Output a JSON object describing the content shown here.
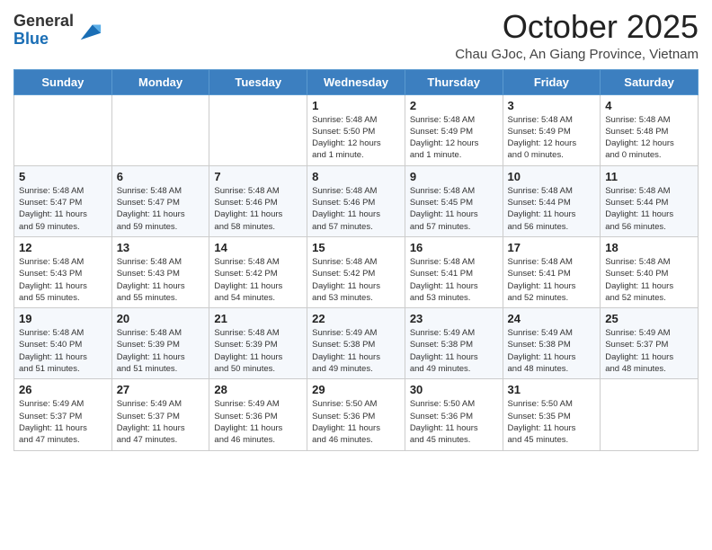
{
  "header": {
    "logo_general": "General",
    "logo_blue": "Blue",
    "month_title": "October 2025",
    "location": "Chau GJoc, An Giang Province, Vietnam"
  },
  "days_of_week": [
    "Sunday",
    "Monday",
    "Tuesday",
    "Wednesday",
    "Thursday",
    "Friday",
    "Saturday"
  ],
  "weeks": [
    [
      {
        "day": "",
        "info": ""
      },
      {
        "day": "",
        "info": ""
      },
      {
        "day": "",
        "info": ""
      },
      {
        "day": "1",
        "info": "Sunrise: 5:48 AM\nSunset: 5:50 PM\nDaylight: 12 hours\nand 1 minute."
      },
      {
        "day": "2",
        "info": "Sunrise: 5:48 AM\nSunset: 5:49 PM\nDaylight: 12 hours\nand 1 minute."
      },
      {
        "day": "3",
        "info": "Sunrise: 5:48 AM\nSunset: 5:49 PM\nDaylight: 12 hours\nand 0 minutes."
      },
      {
        "day": "4",
        "info": "Sunrise: 5:48 AM\nSunset: 5:48 PM\nDaylight: 12 hours\nand 0 minutes."
      }
    ],
    [
      {
        "day": "5",
        "info": "Sunrise: 5:48 AM\nSunset: 5:47 PM\nDaylight: 11 hours\nand 59 minutes."
      },
      {
        "day": "6",
        "info": "Sunrise: 5:48 AM\nSunset: 5:47 PM\nDaylight: 11 hours\nand 59 minutes."
      },
      {
        "day": "7",
        "info": "Sunrise: 5:48 AM\nSunset: 5:46 PM\nDaylight: 11 hours\nand 58 minutes."
      },
      {
        "day": "8",
        "info": "Sunrise: 5:48 AM\nSunset: 5:46 PM\nDaylight: 11 hours\nand 57 minutes."
      },
      {
        "day": "9",
        "info": "Sunrise: 5:48 AM\nSunset: 5:45 PM\nDaylight: 11 hours\nand 57 minutes."
      },
      {
        "day": "10",
        "info": "Sunrise: 5:48 AM\nSunset: 5:44 PM\nDaylight: 11 hours\nand 56 minutes."
      },
      {
        "day": "11",
        "info": "Sunrise: 5:48 AM\nSunset: 5:44 PM\nDaylight: 11 hours\nand 56 minutes."
      }
    ],
    [
      {
        "day": "12",
        "info": "Sunrise: 5:48 AM\nSunset: 5:43 PM\nDaylight: 11 hours\nand 55 minutes."
      },
      {
        "day": "13",
        "info": "Sunrise: 5:48 AM\nSunset: 5:43 PM\nDaylight: 11 hours\nand 55 minutes."
      },
      {
        "day": "14",
        "info": "Sunrise: 5:48 AM\nSunset: 5:42 PM\nDaylight: 11 hours\nand 54 minutes."
      },
      {
        "day": "15",
        "info": "Sunrise: 5:48 AM\nSunset: 5:42 PM\nDaylight: 11 hours\nand 53 minutes."
      },
      {
        "day": "16",
        "info": "Sunrise: 5:48 AM\nSunset: 5:41 PM\nDaylight: 11 hours\nand 53 minutes."
      },
      {
        "day": "17",
        "info": "Sunrise: 5:48 AM\nSunset: 5:41 PM\nDaylight: 11 hours\nand 52 minutes."
      },
      {
        "day": "18",
        "info": "Sunrise: 5:48 AM\nSunset: 5:40 PM\nDaylight: 11 hours\nand 52 minutes."
      }
    ],
    [
      {
        "day": "19",
        "info": "Sunrise: 5:48 AM\nSunset: 5:40 PM\nDaylight: 11 hours\nand 51 minutes."
      },
      {
        "day": "20",
        "info": "Sunrise: 5:48 AM\nSunset: 5:39 PM\nDaylight: 11 hours\nand 51 minutes."
      },
      {
        "day": "21",
        "info": "Sunrise: 5:48 AM\nSunset: 5:39 PM\nDaylight: 11 hours\nand 50 minutes."
      },
      {
        "day": "22",
        "info": "Sunrise: 5:49 AM\nSunset: 5:38 PM\nDaylight: 11 hours\nand 49 minutes."
      },
      {
        "day": "23",
        "info": "Sunrise: 5:49 AM\nSunset: 5:38 PM\nDaylight: 11 hours\nand 49 minutes."
      },
      {
        "day": "24",
        "info": "Sunrise: 5:49 AM\nSunset: 5:38 PM\nDaylight: 11 hours\nand 48 minutes."
      },
      {
        "day": "25",
        "info": "Sunrise: 5:49 AM\nSunset: 5:37 PM\nDaylight: 11 hours\nand 48 minutes."
      }
    ],
    [
      {
        "day": "26",
        "info": "Sunrise: 5:49 AM\nSunset: 5:37 PM\nDaylight: 11 hours\nand 47 minutes."
      },
      {
        "day": "27",
        "info": "Sunrise: 5:49 AM\nSunset: 5:37 PM\nDaylight: 11 hours\nand 47 minutes."
      },
      {
        "day": "28",
        "info": "Sunrise: 5:49 AM\nSunset: 5:36 PM\nDaylight: 11 hours\nand 46 minutes."
      },
      {
        "day": "29",
        "info": "Sunrise: 5:50 AM\nSunset: 5:36 PM\nDaylight: 11 hours\nand 46 minutes."
      },
      {
        "day": "30",
        "info": "Sunrise: 5:50 AM\nSunset: 5:36 PM\nDaylight: 11 hours\nand 45 minutes."
      },
      {
        "day": "31",
        "info": "Sunrise: 5:50 AM\nSunset: 5:35 PM\nDaylight: 11 hours\nand 45 minutes."
      },
      {
        "day": "",
        "info": ""
      }
    ]
  ]
}
